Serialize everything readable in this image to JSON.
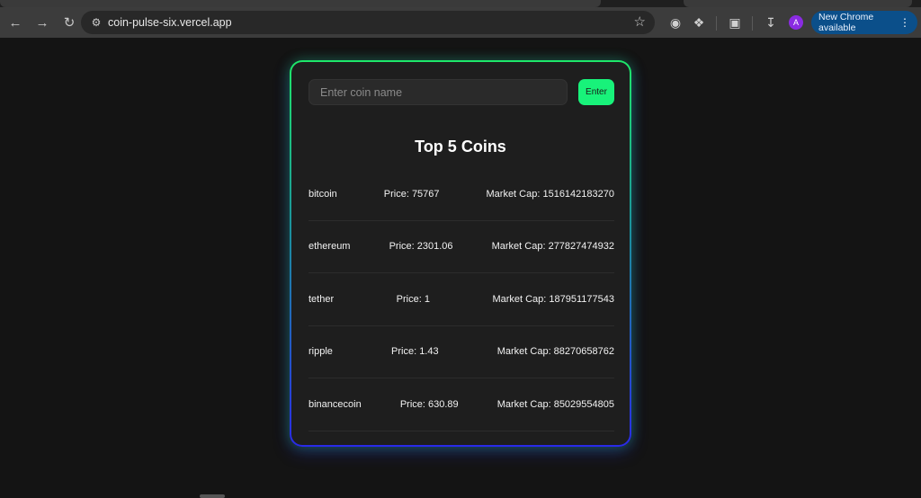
{
  "browser": {
    "url": "coin-pulse-six.vercel.app",
    "update_label": "New Chrome available",
    "avatar_letter": "A"
  },
  "search": {
    "placeholder": "Enter coin name",
    "value": "",
    "button_label": "Enter"
  },
  "heading": "Top 5 Coins",
  "coins": [
    {
      "name": "bitcoin",
      "price": "Price: 75767",
      "market_cap": "Market Cap: 1516142183270"
    },
    {
      "name": "ethereum",
      "price": "Price: 2301.06",
      "market_cap": "Market Cap: 277827474932"
    },
    {
      "name": "tether",
      "price": "Price: 1",
      "market_cap": "Market Cap: 187951177543"
    },
    {
      "name": "ripple",
      "price": "Price: 1.43",
      "market_cap": "Market Cap: 88270658762"
    },
    {
      "name": "binancecoin",
      "price": "Price: 630.89",
      "market_cap": "Market Cap: 85029554805"
    }
  ],
  "colors": {
    "accent": "#18f27a",
    "border_top": "#1ee86a",
    "border_bottom": "#2a2ae8",
    "update_pill": "#0b4f8a"
  }
}
